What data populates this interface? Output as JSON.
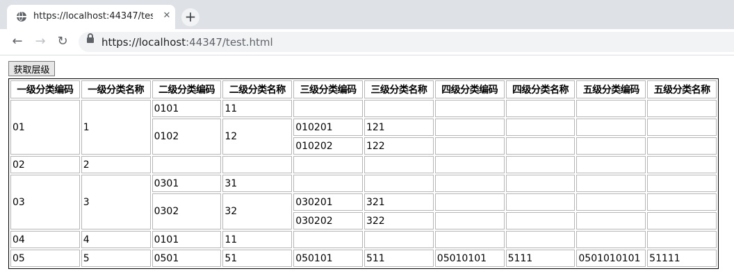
{
  "browser": {
    "tab_title": "https://localhost:44347/test.html",
    "close_glyph": "✕",
    "new_tab_glyph": "+",
    "back_glyph": "←",
    "forward_glyph": "→",
    "reload_glyph": "↻",
    "url_prefix": "https://localhost",
    "url_suffix": ":44347/test.html"
  },
  "page": {
    "button_label": "获取层级"
  },
  "table": {
    "headers": [
      "一级分类编码",
      "一级分类名称",
      "二级分类编码",
      "二级分类名称",
      "三级分类编码",
      "三级分类名称",
      "四级分类编码",
      "四级分类名称",
      "五级分类编码",
      "五级分类名称"
    ],
    "rows": [
      [
        {
          "text": "01",
          "rowspan": 3
        },
        {
          "text": "1",
          "rowspan": 3
        },
        {
          "text": "0101"
        },
        {
          "text": "11"
        },
        {
          "text": ""
        },
        {
          "text": ""
        },
        {
          "text": ""
        },
        {
          "text": ""
        },
        {
          "text": ""
        },
        {
          "text": ""
        }
      ],
      [
        {
          "text": "0102",
          "rowspan": 2
        },
        {
          "text": "12",
          "rowspan": 2
        },
        {
          "text": "010201"
        },
        {
          "text": "121"
        },
        {
          "text": ""
        },
        {
          "text": ""
        },
        {
          "text": ""
        },
        {
          "text": ""
        }
      ],
      [
        {
          "text": "010202"
        },
        {
          "text": "122"
        },
        {
          "text": ""
        },
        {
          "text": ""
        },
        {
          "text": ""
        },
        {
          "text": ""
        }
      ],
      [
        {
          "text": "02"
        },
        {
          "text": "2"
        },
        {
          "text": ""
        },
        {
          "text": ""
        },
        {
          "text": ""
        },
        {
          "text": ""
        },
        {
          "text": ""
        },
        {
          "text": ""
        },
        {
          "text": ""
        },
        {
          "text": ""
        }
      ],
      [
        {
          "text": "03",
          "rowspan": 3
        },
        {
          "text": "3",
          "rowspan": 3
        },
        {
          "text": "0301"
        },
        {
          "text": "31"
        },
        {
          "text": ""
        },
        {
          "text": ""
        },
        {
          "text": ""
        },
        {
          "text": ""
        },
        {
          "text": ""
        },
        {
          "text": ""
        }
      ],
      [
        {
          "text": "0302",
          "rowspan": 2
        },
        {
          "text": "32",
          "rowspan": 2
        },
        {
          "text": "030201"
        },
        {
          "text": "321"
        },
        {
          "text": ""
        },
        {
          "text": ""
        },
        {
          "text": ""
        },
        {
          "text": ""
        }
      ],
      [
        {
          "text": "030202"
        },
        {
          "text": "322"
        },
        {
          "text": ""
        },
        {
          "text": ""
        },
        {
          "text": ""
        },
        {
          "text": ""
        }
      ],
      [
        {
          "text": "04"
        },
        {
          "text": "4"
        },
        {
          "text": "0101"
        },
        {
          "text": "11"
        },
        {
          "text": ""
        },
        {
          "text": ""
        },
        {
          "text": ""
        },
        {
          "text": ""
        },
        {
          "text": ""
        },
        {
          "text": ""
        }
      ],
      [
        {
          "text": "05"
        },
        {
          "text": "5"
        },
        {
          "text": "0501"
        },
        {
          "text": "51"
        },
        {
          "text": "050101"
        },
        {
          "text": "511"
        },
        {
          "text": "05010101"
        },
        {
          "text": "5111"
        },
        {
          "text": "0501010101"
        },
        {
          "text": "51111"
        }
      ]
    ]
  }
}
